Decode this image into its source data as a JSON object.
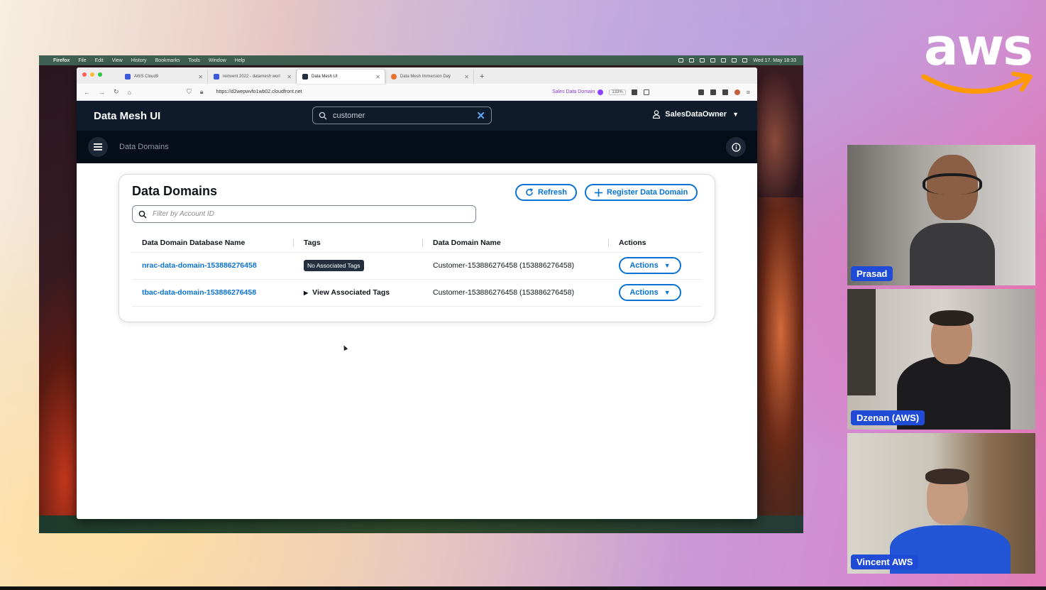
{
  "presentation": {
    "logo_text": "aws",
    "brand_colors": {
      "accent": "#0972d3",
      "name_tag": "#1f4bd6",
      "aws_orange": "#ff9900"
    }
  },
  "macos_menubar": {
    "app": "Firefox",
    "menus": [
      "File",
      "Edit",
      "View",
      "History",
      "Bookmarks",
      "Tools",
      "Window",
      "Help"
    ],
    "clock": "Wed 17. May 18:33"
  },
  "browser": {
    "tabs": [
      {
        "label": "AWS Cloud9",
        "active": false
      },
      {
        "label": "reinvent 2022 - datamesh worl",
        "active": false
      },
      {
        "label": "Data Mesh UI",
        "active": true
      },
      {
        "label": "Data Mesh Immersion Day",
        "active": false
      }
    ],
    "url": "https://d2wepwvfo1wb02.cloudfront.net",
    "container_label": "Sales Data Domain",
    "zoom": "133%"
  },
  "app": {
    "title": "Data Mesh UI",
    "search_value": "customer",
    "user": "SalesDataOwner",
    "breadcrumb": "Data Domains"
  },
  "card": {
    "title": "Data Domains",
    "refresh_label": "Refresh",
    "register_label": "Register Data Domain",
    "filter_placeholder": "Filter by Account ID",
    "columns": [
      "Data Domain Database Name",
      "Tags",
      "Data Domain Name",
      "Actions"
    ],
    "rows": [
      {
        "db_name": "nrac-data-domain-153886276458",
        "tags": "No Associated Tags",
        "domain_name": "Customer-153886276458 (153886276458)",
        "action": "Actions"
      },
      {
        "db_name": "tbac-data-domain-153886276458",
        "tags": "View Associated Tags",
        "domain_name": "Customer-153886276458 (153886276458)",
        "action": "Actions"
      }
    ]
  },
  "participants": [
    {
      "name": "Prasad"
    },
    {
      "name": "Dzenan (AWS)"
    },
    {
      "name": "Vincent AWS"
    }
  ]
}
